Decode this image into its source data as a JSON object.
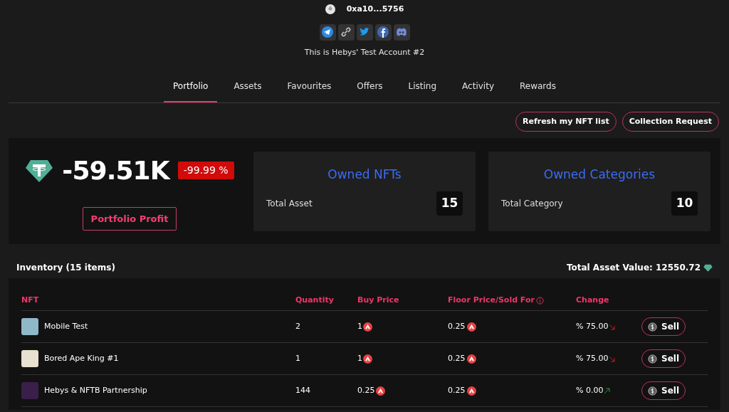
{
  "profile": {
    "address": "0xa10...5756",
    "socials": [
      {
        "kind": "telegram"
      },
      {
        "kind": "link"
      },
      {
        "kind": "twitter"
      },
      {
        "kind": "facebook"
      },
      {
        "kind": "discord"
      }
    ],
    "bio": "This is Hebys' Test Account #2"
  },
  "tabs": [
    {
      "label": "Portfolio",
      "selected": true
    },
    {
      "label": "Assets",
      "selected": false
    },
    {
      "label": "Favourites",
      "selected": false
    },
    {
      "label": "Offers",
      "selected": false
    },
    {
      "label": "Listing",
      "selected": false
    },
    {
      "label": "Activity",
      "selected": false
    },
    {
      "label": "Rewards",
      "selected": false
    }
  ],
  "actions": [
    "Refresh my NFT list",
    "Collection Request"
  ],
  "summary": {
    "value": "-59.51K",
    "change": "-99.99 %",
    "profit_button": "Portfolio Profit",
    "cards": [
      {
        "title": "Owned NFTs",
        "label": "Total Asset",
        "count": "15"
      },
      {
        "title": "Owned Categories",
        "label": "Total Category",
        "count": "10"
      }
    ]
  },
  "inventory": {
    "title": "Inventory (15 items)",
    "total": "Total Asset Value: 12550.72",
    "columns": [
      "NFT",
      "Quantity",
      "Buy Price",
      "Floor Price/Sold For",
      "Change"
    ],
    "rows": [
      {
        "name": "Mobile Test",
        "quantity": "2",
        "buy_price": "1",
        "floor_price": "0.25",
        "change": "% 75.00",
        "kind": "down",
        "action": "Sell"
      },
      {
        "name": "Bored Ape King #1",
        "quantity": "1",
        "buy_price": "1",
        "floor_price": "0.25",
        "change": "% 75.00",
        "kind": "down",
        "action": "Sell"
      },
      {
        "name": "Hebys & NFTB Partnership",
        "quantity": "144",
        "buy_price": "0.25",
        "floor_price": "0.25",
        "change": "% 0.00",
        "kind": "up",
        "action": "Sell"
      }
    ]
  }
}
